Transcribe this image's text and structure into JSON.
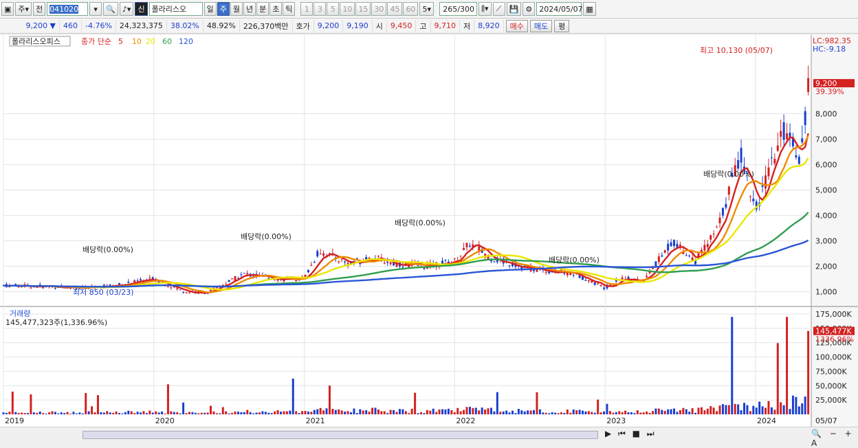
{
  "toolbar": {
    "market": "주",
    "prev_btn": "전",
    "code": "041020",
    "name": "폴라리스오",
    "periods": [
      "일",
      "주",
      "월",
      "년",
      "분",
      "초",
      "틱"
    ],
    "active_period": "주",
    "mins": [
      "1",
      "3",
      "5",
      "10",
      "15",
      "30",
      "45",
      "60"
    ],
    "min_sel": "5",
    "count": "265",
    "count_total": "/300",
    "date": "2024/05/07",
    "icons": [
      "dropdown-icon",
      "search-icon",
      "speaker-icon",
      "shin-badge",
      "candle-type-icon",
      "draw-tools-icon",
      "save-icon",
      "settings-icon",
      "calendar-icon"
    ]
  },
  "quote": {
    "price": "9,200",
    "change": "460",
    "rate": "-4.76%",
    "volume": "24,323,375",
    "turnover": "38.02%",
    "ratio": "48.92%",
    "amount": "226,370백만",
    "bid_label": "호가",
    "ask": "9,200",
    "bid": "9,190",
    "open_label": "시",
    "open": "9,450",
    "high_label": "고",
    "high": "9,710",
    "low_label": "저",
    "low": "8,920",
    "buy": "매수",
    "sell": "매도",
    "eval": "평",
    "colors": {
      "down": "#1a3fd0",
      "up": "#d42020"
    }
  },
  "chart_data": [
    {
      "type": "candlestick",
      "legend": {
        "name": "폴라리스오피스",
        "ma_label": "종가 단순",
        "periods": [
          "5",
          "10",
          "20",
          "60",
          "120"
        ],
        "colors": [
          "#d42020",
          "#f08a00",
          "#e8e800",
          "#2e9e4e",
          "#2a55d8"
        ]
      },
      "ylim": [
        500,
        10500
      ],
      "yticks": [
        "1,000",
        "2,000",
        "3,000",
        "4,000",
        "5,000",
        "6,000",
        "7,000",
        "8,000"
      ],
      "last_price": "9,200",
      "last_rate": "39.39%",
      "lc": "LC:982.35",
      "hc": "HC:-9.18",
      "x_labels": [
        "2019",
        "2020",
        "2021",
        "2022",
        "2023",
        "2024",
        "05/07"
      ],
      "annotations": {
        "high": "최고 10,130 (05/07)",
        "low": "최저 850 (03/23)",
        "dividend": [
          "배당락(0.00%)",
          "배당락(0.00%)",
          "배당락(0.00%)",
          "배당락(0.00%)",
          "배당락(0.00%)"
        ]
      },
      "price_path": [
        [
          2019.0,
          1250
        ],
        [
          2019.3,
          1200
        ],
        [
          2019.6,
          1150
        ],
        [
          2019.8,
          1300
        ],
        [
          2020.0,
          1500
        ],
        [
          2020.2,
          1000
        ],
        [
          2020.35,
          950
        ],
        [
          2020.6,
          1700
        ],
        [
          2020.9,
          1450
        ],
        [
          2021.0,
          1550
        ],
        [
          2021.1,
          2600
        ],
        [
          2021.3,
          2100
        ],
        [
          2021.45,
          2350
        ],
        [
          2021.6,
          2100
        ],
        [
          2021.8,
          2000
        ],
        [
          2022.0,
          2200
        ],
        [
          2022.1,
          2900
        ],
        [
          2022.25,
          2300
        ],
        [
          2022.5,
          1900
        ],
        [
          2022.8,
          1700
        ],
        [
          2023.0,
          1150
        ],
        [
          2023.1,
          1550
        ],
        [
          2023.25,
          1400
        ],
        [
          2023.45,
          3000
        ],
        [
          2023.6,
          2200
        ],
        [
          2023.75,
          3500
        ],
        [
          2023.9,
          6500
        ],
        [
          2024.0,
          4200
        ],
        [
          2024.2,
          7500
        ],
        [
          2024.3,
          6200
        ],
        [
          2024.35,
          9200
        ]
      ],
      "vol_title": "거래량",
      "vol_value": "145,477,323주(1,336.96%)",
      "vol_last": "145,477K",
      "vol_rate": "1336.96%",
      "vol_ylim": [
        0,
        175000
      ],
      "vol_ticks": [
        "25,000K",
        "50,000K",
        "75,000K",
        "100,000K",
        "125,000K",
        "150,000K",
        "175,000K"
      ]
    }
  ]
}
